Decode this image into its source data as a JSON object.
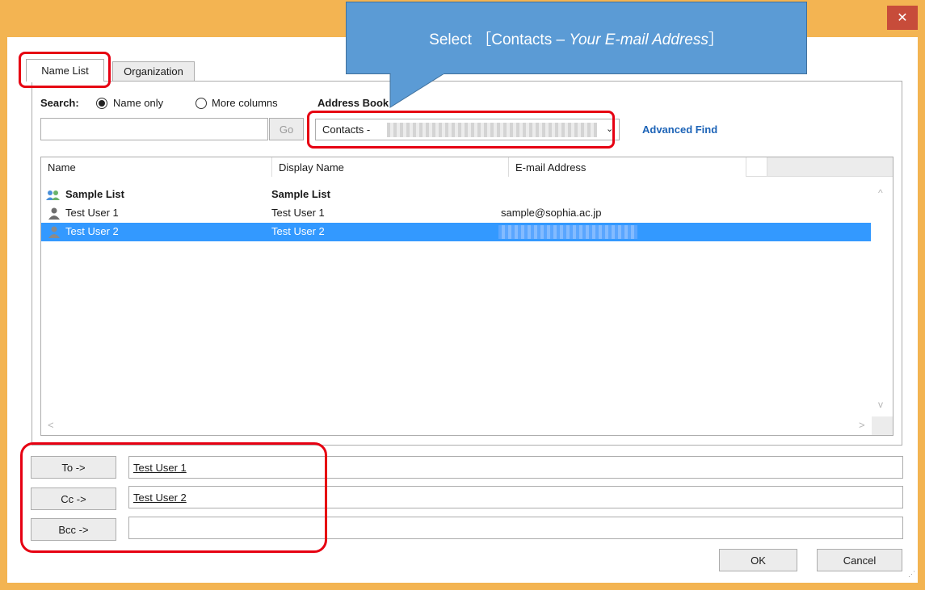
{
  "window": {
    "close_glyph": "✕"
  },
  "tabs": [
    {
      "label": "Name List",
      "active": true
    },
    {
      "label": "Organization",
      "active": false
    }
  ],
  "search": {
    "label": "Search:",
    "options": [
      "Name only",
      "More columns"
    ],
    "selected": "Name only",
    "value": "",
    "go_label": "Go"
  },
  "address_book": {
    "label": "Address Book",
    "selected_prefix": "Contacts -",
    "advanced_find": "Advanced Find"
  },
  "list": {
    "columns": [
      "Name",
      "Display Name",
      "E-mail Address"
    ],
    "rows": [
      {
        "name": "Sample List",
        "display": "Sample List",
        "email": "",
        "icon": "group-icon",
        "bold": true,
        "selected": false
      },
      {
        "name": "Test User 1",
        "display": "Test User 1",
        "email": "sample@sophia.ac.jp",
        "icon": "person-icon",
        "bold": false,
        "selected": false
      },
      {
        "name": "Test User 2",
        "display": "Test User 2",
        "email": "",
        "icon": "person-icon",
        "bold": false,
        "selected": true
      }
    ]
  },
  "recipients": {
    "to_label": "To ->",
    "cc_label": "Cc ->",
    "bcc_label": "Bcc ->",
    "to_value": "Test User 1",
    "cc_value": "Test User 2",
    "bcc_value": ""
  },
  "buttons": {
    "ok": "OK",
    "cancel": "Cancel"
  },
  "callout": {
    "prefix": "Select ［Contacts – ",
    "italic": "Your E-mail Address",
    "suffix": "］"
  },
  "colors": {
    "frame": "#f3b452",
    "selection": "#3399ff",
    "link": "#1c63b7",
    "highlight": "#e60012",
    "callout": "#5b9bd5"
  }
}
